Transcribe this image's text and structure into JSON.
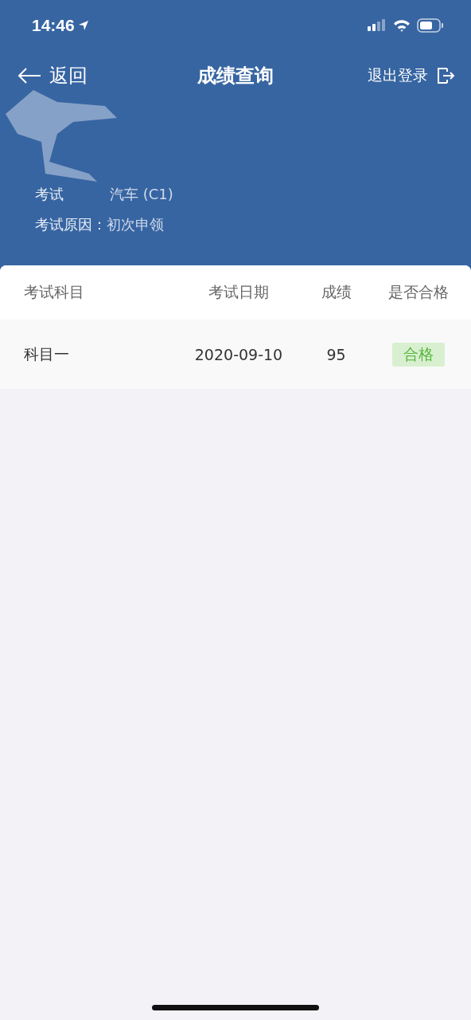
{
  "status_bar": {
    "time": "14:46"
  },
  "nav": {
    "back_label": "返回",
    "title": "成绩查询",
    "logout_label": "退出登录"
  },
  "info": [
    {
      "label": "考试",
      "value": "汽车 (C1)",
      "redacted": true
    },
    {
      "label": "考试原因：",
      "value": "初次申领"
    }
  ],
  "table": {
    "columns": [
      "考试科目",
      "考试日期",
      "成绩",
      "是否合格"
    ],
    "rows": [
      {
        "subject": "科目一",
        "date": "2020-09-10",
        "score": "95",
        "result": "合格",
        "passed": true
      }
    ]
  }
}
